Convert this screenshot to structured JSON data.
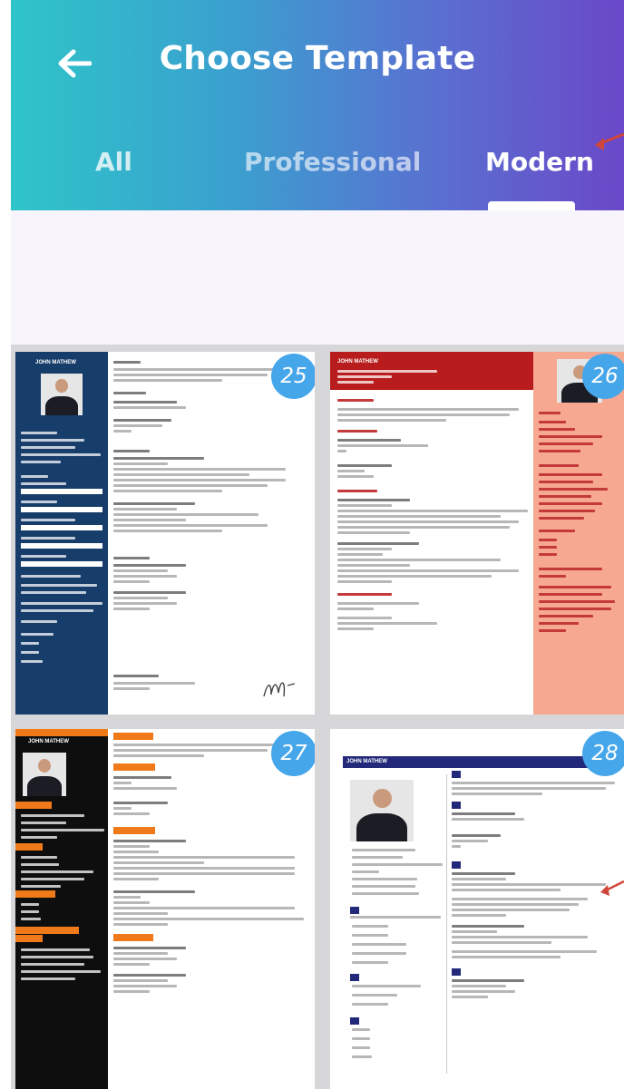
{
  "header": {
    "title": "Choose Template",
    "back_icon": "arrow-left-icon",
    "tabs": [
      {
        "label": "All",
        "selected": false
      },
      {
        "label": "Professional",
        "selected": false
      },
      {
        "label": "Modern",
        "selected": true
      }
    ]
  },
  "colors": {
    "gradient_start": "#2ec5c9",
    "gradient_end": "#6a48c8",
    "badge": "#45a6ea",
    "template25_sidebar": "#173d6b",
    "template26_accent": "#b81c1c",
    "template26_side": "#f6a891",
    "template27_accent": "#f07a1a",
    "template28_accent": "#22287a"
  },
  "templates": [
    {
      "number": "25",
      "name": "JOHN MATHEW"
    },
    {
      "number": "26",
      "name": "JOHN MATHEW"
    },
    {
      "number": "27",
      "name": "JOHN MATHEW"
    },
    {
      "number": "28",
      "name": "JOHN MATHEW"
    }
  ]
}
